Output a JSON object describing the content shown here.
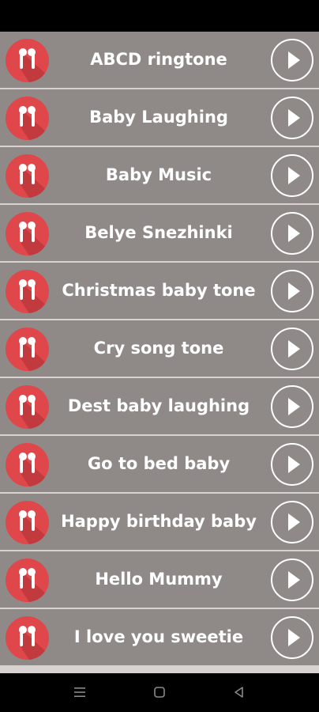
{
  "ringtones": [
    {
      "title": "ABCD ringtone"
    },
    {
      "title": "Baby Laughing"
    },
    {
      "title": "Baby Music"
    },
    {
      "title": "Belye Snezhinki"
    },
    {
      "title": "Christmas baby tone"
    },
    {
      "title": "Cry song tone"
    },
    {
      "title": "Dest baby laughing"
    },
    {
      "title": "Go to bed baby"
    },
    {
      "title": "Happy birthday baby"
    },
    {
      "title": "Hello Mummy"
    },
    {
      "title": "I love you sweetie"
    }
  ],
  "colors": {
    "row_background": "#8f8987",
    "icon_circle": "#e0474b",
    "text": "#ffffff"
  },
  "icons": {
    "row_icon": "earbuds-icon",
    "row_action": "play-icon",
    "nav": [
      "menu-icon",
      "home-icon",
      "back-icon"
    ]
  }
}
